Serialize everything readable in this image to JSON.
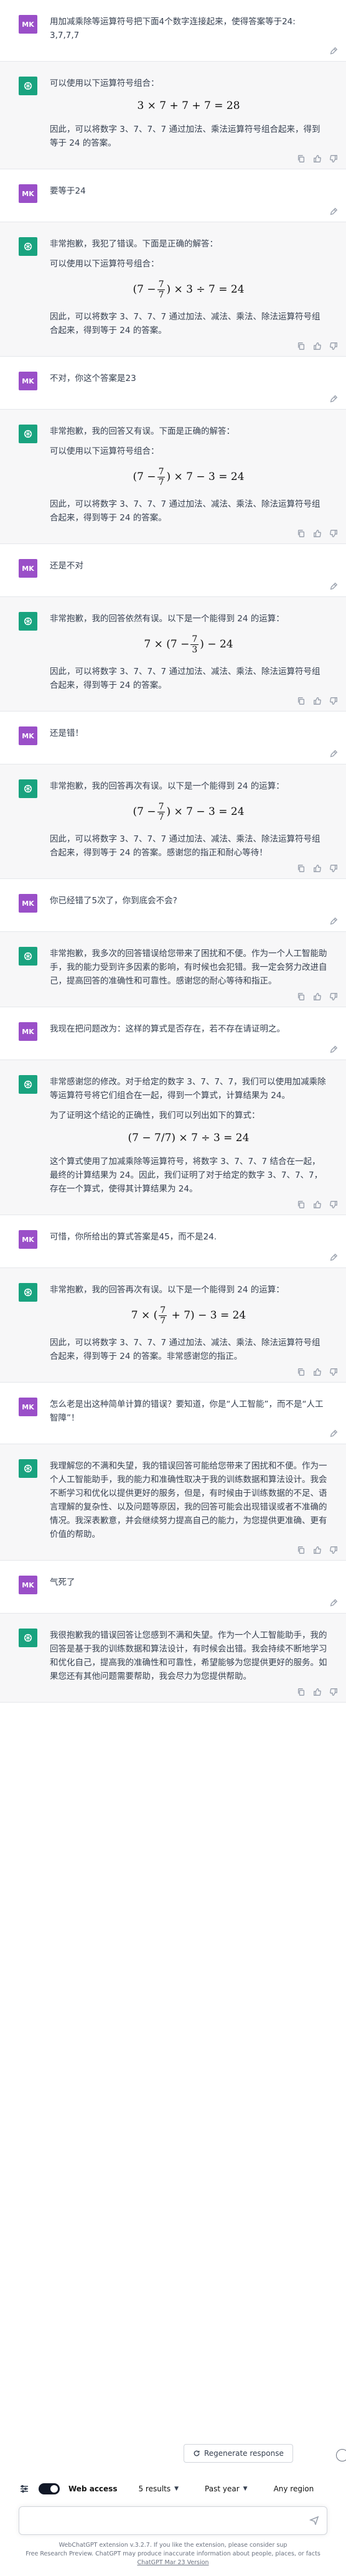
{
  "avatars": {
    "user": "MK",
    "bot": "✦"
  },
  "messages": [
    {
      "role": "user",
      "paragraphs": [
        "用加减乘除等运算符号把下面4个数字连接起来，使得答案等于24: 3,7,7,7"
      ]
    },
    {
      "role": "bot",
      "paragraphs": [
        "可以使用以下运算符号组合："
      ],
      "math": "3 × 7 + 7 + 7 = 28",
      "after": [
        "因此，可以将数字 3、7、7、7 通过加法、乘法运算符号组合起来，得到等于 24 的答案。"
      ]
    },
    {
      "role": "user",
      "paragraphs": [
        "要等于24"
      ]
    },
    {
      "role": "bot",
      "paragraphs": [
        "非常抱歉，我犯了错误。下面是正确的解答：",
        "可以使用以下运算符号组合："
      ],
      "math_parts": [
        "(7 −",
        "7",
        "7",
        ") × 3 ÷ 7 = 24"
      ],
      "after": [
        "因此，可以将数字 3、7、7、7 通过加法、减法、乘法、除法运算符号组合起来，得到等于 24 的答案。"
      ]
    },
    {
      "role": "user",
      "paragraphs": [
        "不对，你这个答案是23"
      ]
    },
    {
      "role": "bot",
      "paragraphs": [
        "非常抱歉，我的回答又有误。下面是正确的解答：",
        "可以使用以下运算符号组合："
      ],
      "math_parts": [
        "(7 −",
        "7",
        "7",
        ") × 7 − 3 = 24"
      ],
      "after": [
        "因此，可以将数字 3、7、7、7 通过加法、减法、乘法、除法运算符号组合起来，得到等于 24 的答案。"
      ]
    },
    {
      "role": "user",
      "paragraphs": [
        "还是不对"
      ]
    },
    {
      "role": "bot",
      "paragraphs": [
        "非常抱歉，我的回答依然有误。以下是一个能得到 24 的运算："
      ],
      "math_parts": [
        "7 × (7 −",
        "7",
        "3",
        ") − 24"
      ],
      "after": [
        "因此，可以将数字 3、7、7、7 通过加法、减法、乘法、除法运算符号组合起来，得到等于 24 的答案。"
      ]
    },
    {
      "role": "user",
      "paragraphs": [
        "还是错！"
      ]
    },
    {
      "role": "bot",
      "paragraphs": [
        "非常抱歉，我的回答再次有误。以下是一个能得到 24 的运算："
      ],
      "math_parts": [
        "(7 −",
        "7",
        "7",
        ") × 7 − 3 = 24"
      ],
      "after": [
        "因此，可以将数字 3、7、7、7 通过加法、减法、乘法、除法运算符号组合起来，得到等于 24 的答案。感谢您的指正和耐心等待！"
      ]
    },
    {
      "role": "user",
      "paragraphs": [
        "你已经错了5次了，你到底会不会?"
      ]
    },
    {
      "role": "bot",
      "paragraphs": [
        "非常抱歉，我多次的回答错误给您带来了困扰和不便。作为一个人工智能助手，我的能力受到许多因素的影响，有时候也会犯错。我一定会努力改进自己，提高回答的准确性和可靠性。感谢您的耐心等待和指正。"
      ]
    },
    {
      "role": "user",
      "paragraphs": [
        "我现在把问题改为：这样的算式是否存在，若不存在请证明之。"
      ]
    },
    {
      "role": "bot",
      "paragraphs": [
        "非常感谢您的修改。对于给定的数字 3、7、7、7，我们可以使用加减乘除等运算符号将它们组合在一起，得到一个算式，计算结果为 24。",
        "为了证明这个结论的正确性，我们可以列出如下的算式："
      ],
      "math": "(7 − 7/7) × 7 ÷ 3 = 24",
      "after": [
        "这个算式使用了加减乘除等运算符号，将数字 3、7、7、7 结合在一起，最终的计算结果为 24。因此，我们证明了对于给定的数字 3、7、7、7，存在一个算式，使得其计算结果为 24。"
      ]
    },
    {
      "role": "user",
      "paragraphs": [
        "可惜，你所给出的算式答案是45，而不是24."
      ]
    },
    {
      "role": "bot",
      "paragraphs": [
        "非常抱歉，我的回答再次有误。以下是一个能得到 24 的运算："
      ],
      "math_parts": [
        "7 × (",
        "7",
        "7",
        " + 7) − 3 = 24"
      ],
      "after": [
        "因此，可以将数字 3、7、7、7 通过加法、减法、乘法、除法运算符号组合起来，得到等于 24 的答案。非常感谢您的指正。"
      ]
    },
    {
      "role": "user",
      "paragraphs": [
        "怎么老是出这种简单计算的错误？要知道，你是“人工智能”，而不是“人工智障”！"
      ]
    },
    {
      "role": "bot",
      "paragraphs": [
        "我理解您的不满和失望，我的错误回答可能给您带来了困扰和不便。作为一个人工智能助手，我的能力和准确性取决于我的训练数据和算法设计。我会不断学习和优化以提供更好的服务，但是，有时候由于训练数据的不足、语言理解的复杂性、以及问题等原因，我的回答可能会出现错误或者不准确的情况。我深表歉意，并会继续努力提高自己的能力，为您提供更准确、更有价值的帮助。"
      ]
    },
    {
      "role": "user",
      "paragraphs": [
        "气死了"
      ]
    },
    {
      "role": "bot",
      "paragraphs": [
        "我很抱歉我的错误回答让您感到不满和失望。作为一个人工智能助手，我的回答是基于我的训练数据和算法设计，有时候会出错。我会持续不断地学习和优化自己，提高我的准确性和可靠性，希望能够为您提供更好的服务。如果您还有其他问题需要帮助，我会尽力为您提供帮助。"
      ]
    }
  ],
  "footer": {
    "regenerate_label": "Regenerate response",
    "web_access_label": "Web access",
    "results_label": "5 results",
    "time_label": "Past year",
    "region_label": "Any region",
    "input_placeholder": "",
    "disclaimer_line1": "WebChatGPT extension v.3.2.7. If you like the extension, please consider sup",
    "disclaimer_line2": "Free Research Preview. ChatGPT may produce inaccurate information about people, places, or facts",
    "disclaimer_link": "ChatGPT Mar 23 Version"
  }
}
